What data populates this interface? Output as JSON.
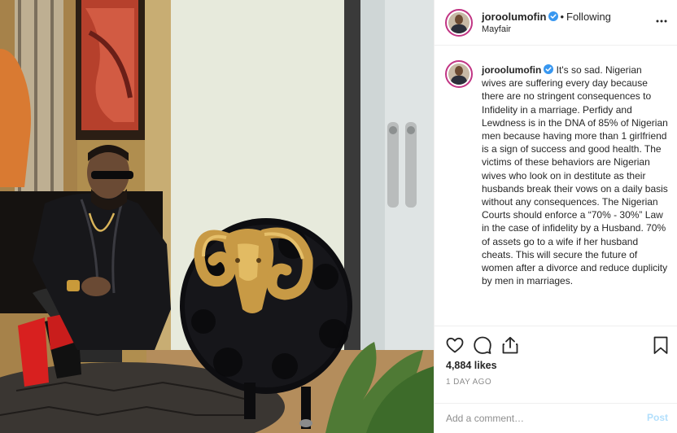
{
  "post": {
    "author": {
      "username": "joroolumofin",
      "verified": true,
      "verified_icon": "verified-badge-icon",
      "avatar_icon": "profile-avatar"
    },
    "header": {
      "separator": "•",
      "follow_status": "Following",
      "location": "Mayfair",
      "more_icon": "more-options-icon"
    },
    "caption": {
      "text": "It's so sad. Nigerian wives are suffering every day because there are no stringent consequences to Infidelity in a marriage. Perfidy and Lewdness is in the DNA of 85% of Nigerian men because having more than 1 girlfriend is a sign of success and good health. The victims of these behaviors are Nigerian wives who look on in destitute as their husbands break their vows on a daily basis without any consequences. The Nigerian Courts should enforce a “70% - 30%” Law in the case of infidelity by a Husband. 70% of assets go to a wife if her husband cheats. This will secure the future of women after a divorce and reduce duplicity by men in marriages."
    },
    "actions": {
      "like_icon": "heart-icon",
      "comment_icon": "comment-bubble-icon",
      "share_icon": "share-icon",
      "save_icon": "bookmark-icon"
    },
    "likes": "4,884 likes",
    "age": "1 DAY AGO",
    "comment": {
      "placeholder": "Add a comment…",
      "post_label": "Post"
    },
    "colors": {
      "text": "#262626",
      "muted": "#8e8e8e",
      "divider": "#efefef",
      "verified": "#3897f0",
      "post_disabled": "#b2dffc",
      "avatar_ring": "#c13584"
    },
    "photo": {
      "description_icon": "photo-man-with-ram-sculpture"
    }
  }
}
